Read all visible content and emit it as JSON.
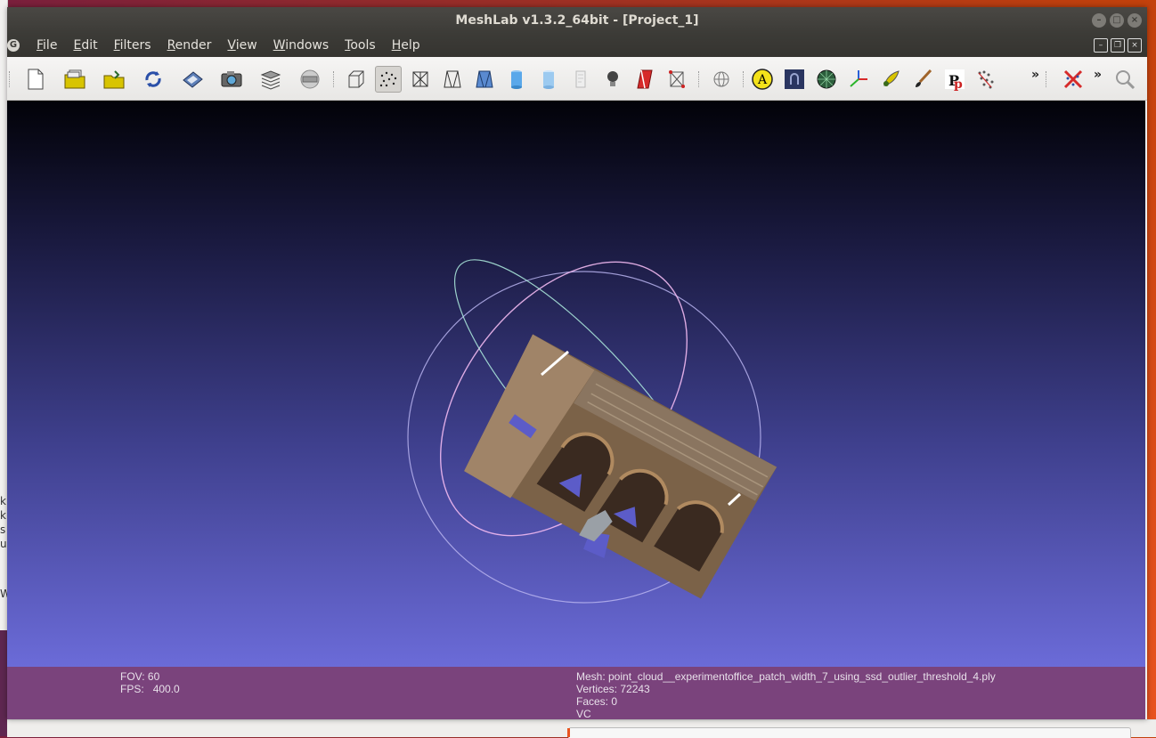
{
  "window": {
    "title": "MeshLab v1.3.2_64bit - [Project_1]"
  },
  "menu": {
    "items": [
      {
        "label": "File",
        "mnemonic": "F",
        "rest": "ile"
      },
      {
        "label": "Edit",
        "mnemonic": "E",
        "rest": "dit"
      },
      {
        "label": "Filters",
        "mnemonic": "F",
        "rest": "ilters"
      },
      {
        "label": "Render",
        "mnemonic": "R",
        "rest": "ender"
      },
      {
        "label": "View",
        "mnemonic": "V",
        "rest": "iew"
      },
      {
        "label": "Windows",
        "mnemonic": "W",
        "rest": "indows"
      },
      {
        "label": "Tools",
        "mnemonic": "T",
        "rest": "ools"
      },
      {
        "label": "Help",
        "mnemonic": "H",
        "rest": "elp"
      }
    ]
  },
  "toolbar": {
    "overflow_label": "»",
    "icons": [
      "new-project-icon",
      "open-project-icon",
      "import-mesh-icon",
      "reload-icon",
      "save-icon",
      "snapshot-icon",
      "layers-icon",
      "bounding-box-globe-icon",
      "bbox-render-icon",
      "points-render-icon",
      "wireframe-icon",
      "hidden-lines-icon",
      "flat-lines-icon",
      "flat-render-icon",
      "smooth-render-icon",
      "texture-icon",
      "light-icon",
      "fancy-lighting-icon",
      "back-face-icon",
      "trackball-icon",
      "annotation-a-icon",
      "measure-icon",
      "sphere-icon",
      "axis-icon",
      "select-brush-icon",
      "paint-icon",
      "pick-points-icon",
      "align-icon",
      "delete-selection-icon",
      "zoom-search-icon"
    ]
  },
  "info": {
    "fov": "FOV: 60",
    "fps_label": "FPS:",
    "fps_value": "400.0",
    "mesh": "Mesh: point_cloud__experimentoffice_patch_width_7_using_ssd_outlier_threshold_4.ply",
    "vertices": "Vertices: 72243",
    "faces": "Faces: 0",
    "vc": "VC"
  },
  "colors": {
    "title_bg": "#3c3b37",
    "info_bg": "#7a437c",
    "viewport_top": "#020208",
    "viewport_bottom": "#6b6bd8",
    "desktop_accent": "#e95420"
  }
}
